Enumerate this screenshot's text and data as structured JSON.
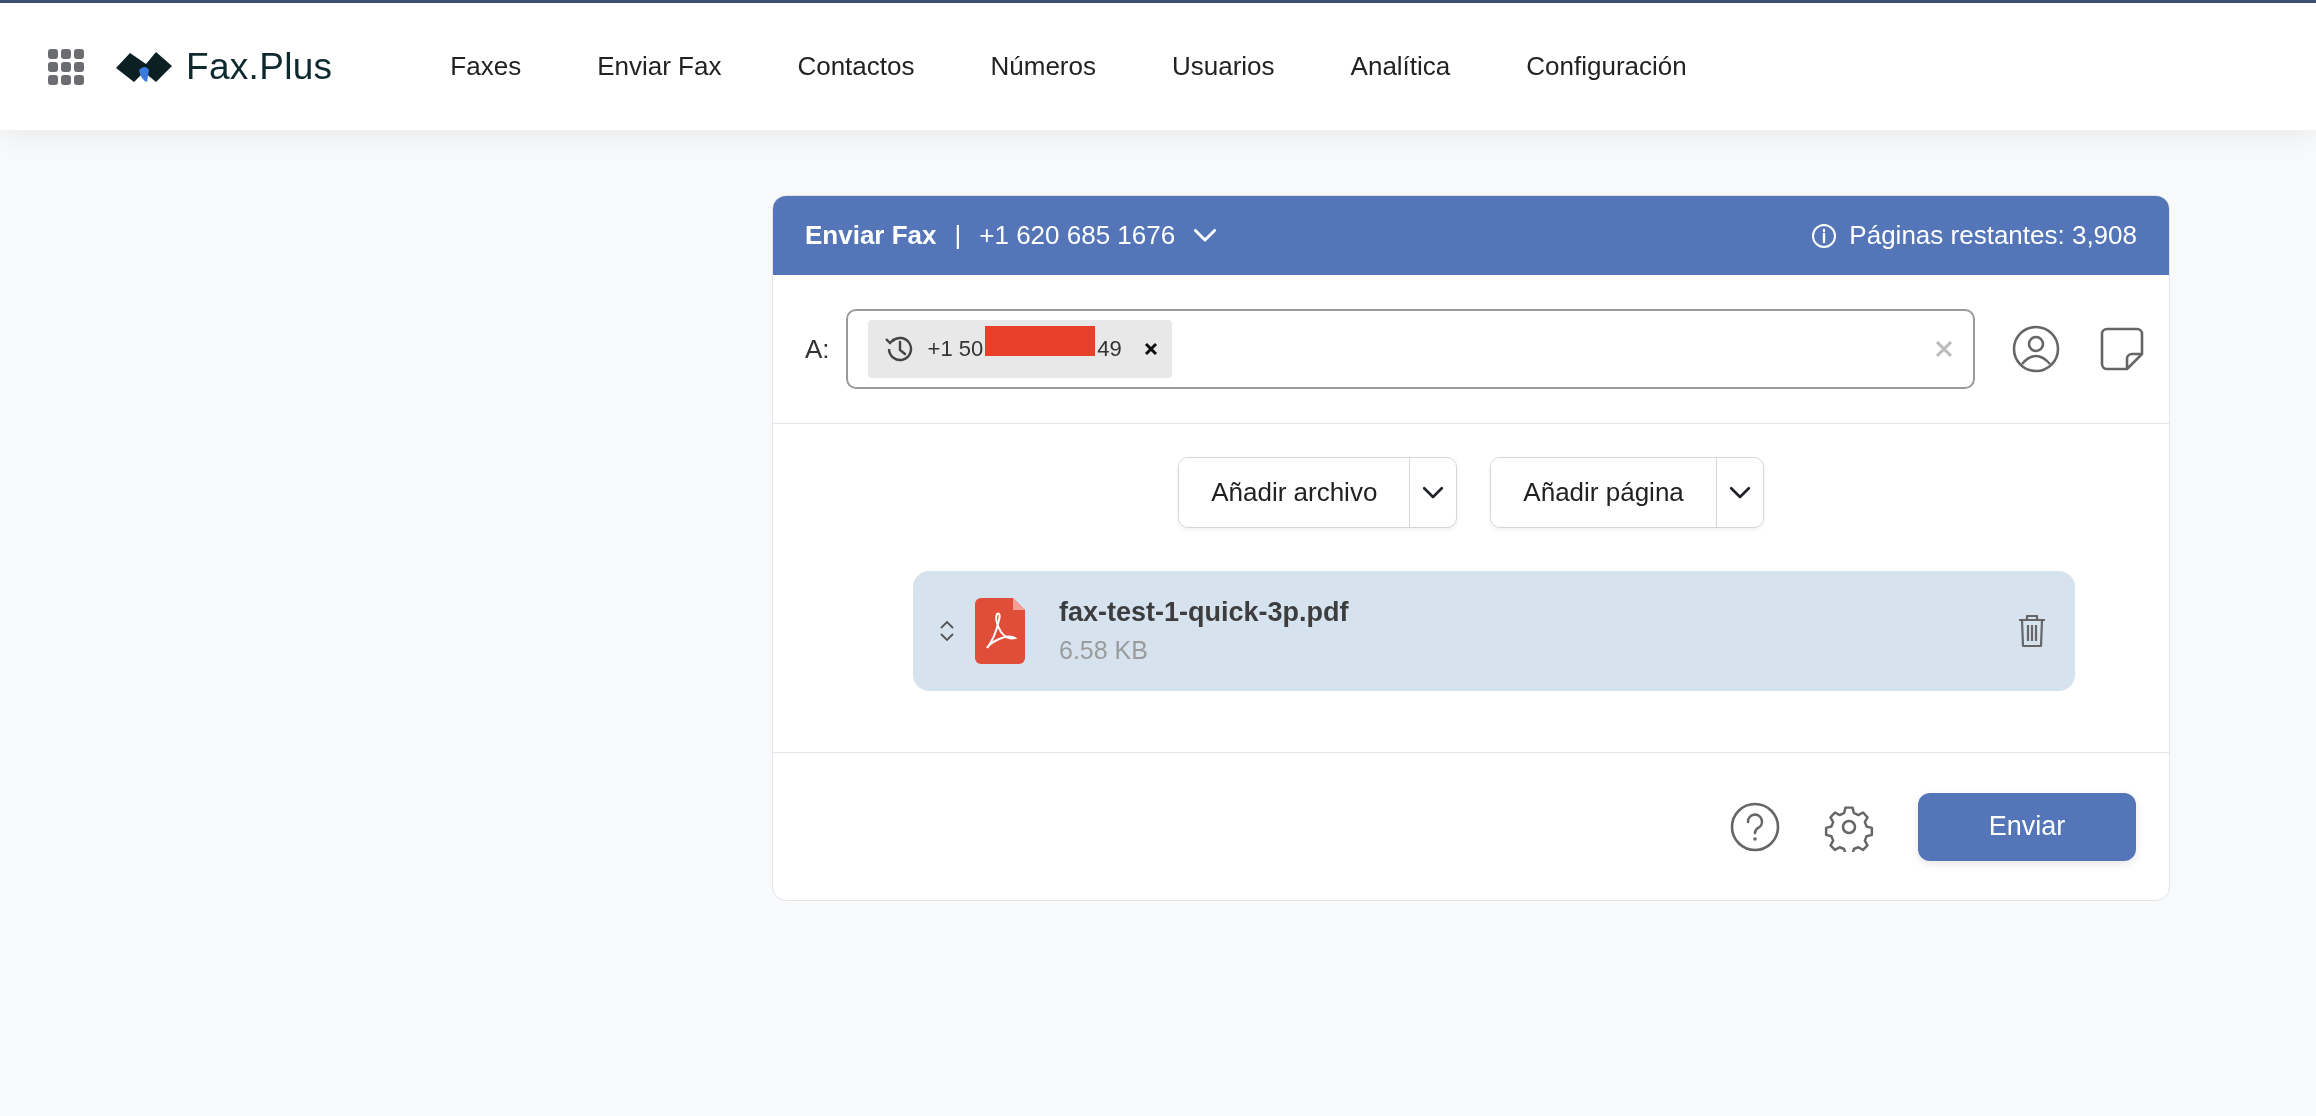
{
  "header": {
    "logo": "Fax.Plus",
    "nav": [
      "Faxes",
      "Enviar Fax",
      "Contactos",
      "Números",
      "Usuarios",
      "Analítica",
      "Configuración"
    ]
  },
  "card": {
    "title": "Enviar Fax",
    "separator": "|",
    "number": "+1 620 685 1676",
    "pages_remaining": "Páginas restantes: 3,908",
    "recipient": {
      "label": "A:",
      "chips": [
        {
          "text_start": "+1 50",
          "text_end": "49",
          "redacted": true
        }
      ]
    },
    "add_buttons": [
      "Añadir archivo",
      "Añadir página"
    ],
    "files": [
      {
        "name": "fax-test-1-quick-3p.pdf",
        "size": "6.58 KB"
      }
    ],
    "send": "Enviar"
  }
}
